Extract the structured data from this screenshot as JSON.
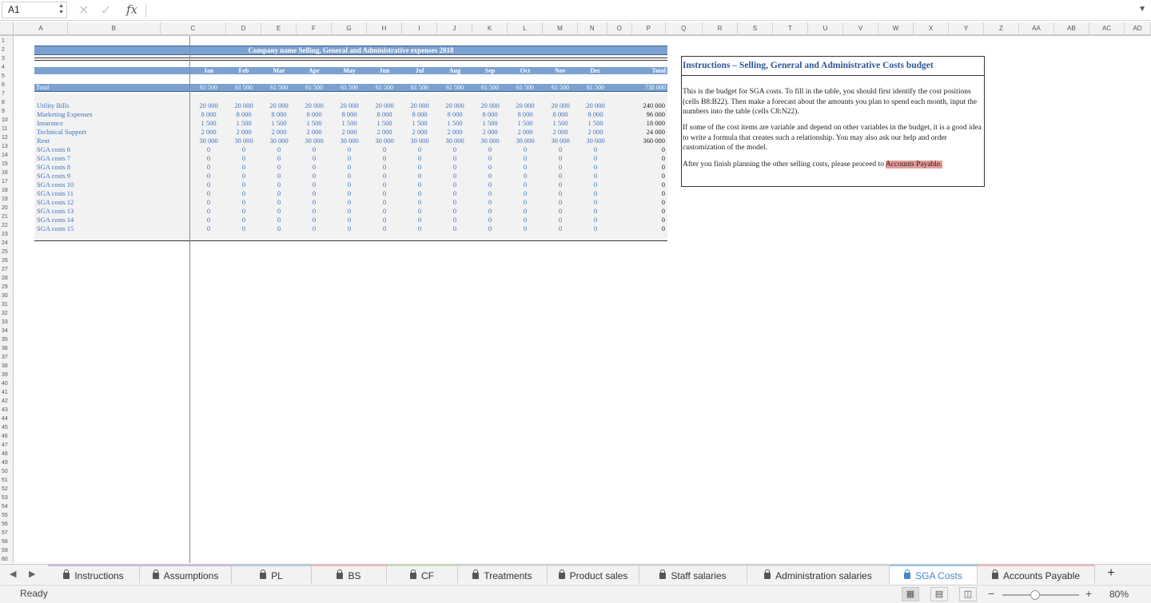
{
  "formula_bar": {
    "name_box": "A1",
    "formula": "",
    "fx": "fx",
    "cancel": "✕",
    "confirm": "✓"
  },
  "columns": [
    "A",
    "B",
    "C",
    "D",
    "E",
    "F",
    "G",
    "H",
    "I",
    "J",
    "K",
    "L",
    "M",
    "N",
    "O",
    "P",
    "Q",
    "R",
    "S",
    "T",
    "U",
    "V",
    "W",
    "X",
    "Y",
    "Z",
    "AA",
    "AB",
    "AC",
    "AD"
  ],
  "rows_visible": 60,
  "sheet": {
    "title": "Company name Selling, General and Administrative expenses 2018",
    "months": [
      "Jan",
      "Feb",
      "Mar",
      "Apr",
      "May",
      "Jun",
      "Jul",
      "Aug",
      "Sep",
      "Oct",
      "Nov",
      "Dec"
    ],
    "total_header": "Total",
    "total_row": {
      "label": "Total",
      "values": [
        "61 500",
        "61 500",
        "61 500",
        "61 500",
        "61 500",
        "61 500",
        "61 500",
        "61 500",
        "61 500",
        "61 500",
        "61 500",
        "61 500"
      ],
      "total": "738 000"
    },
    "items": [
      {
        "label": "Utility Bills",
        "values": [
          "20 000",
          "20 000",
          "20 000",
          "20 000",
          "20 000",
          "20 000",
          "20 000",
          "20 000",
          "20 000",
          "20 000",
          "20 000",
          "20 000"
        ],
        "total": "240 000"
      },
      {
        "label": "Marketing Expenses",
        "values": [
          "8 000",
          "8 000",
          "8 000",
          "8 000",
          "8 000",
          "8 000",
          "8 000",
          "8 000",
          "8 000",
          "8 000",
          "8 000",
          "8 000"
        ],
        "total": "96 000"
      },
      {
        "label": "Insurance",
        "values": [
          "1 500",
          "1 500",
          "1 500",
          "1 500",
          "1 500",
          "1 500",
          "1 500",
          "1 500",
          "1 500",
          "1 500",
          "1 500",
          "1 500"
        ],
        "total": "18 000"
      },
      {
        "label": "Technical Support",
        "values": [
          "2 000",
          "2 000",
          "2 000",
          "2 000",
          "2 000",
          "2 000",
          "2 000",
          "2 000",
          "2 000",
          "2 000",
          "2 000",
          "2 000"
        ],
        "total": "24 000"
      },
      {
        "label": "Rent",
        "values": [
          "30 000",
          "30 000",
          "30 000",
          "30 000",
          "30 000",
          "30 000",
          "30 000",
          "30 000",
          "30 000",
          "30 000",
          "30 000",
          "30 000"
        ],
        "total": "360 000"
      },
      {
        "label": "SGA costs 6",
        "values": [
          "0",
          "0",
          "0",
          "0",
          "0",
          "0",
          "0",
          "0",
          "0",
          "0",
          "0",
          "0"
        ],
        "total": "0"
      },
      {
        "label": "SGA costs 7",
        "values": [
          "0",
          "0",
          "0",
          "0",
          "0",
          "0",
          "0",
          "0",
          "0",
          "0",
          "0",
          "0"
        ],
        "total": "0"
      },
      {
        "label": "SGA costs 8",
        "values": [
          "0",
          "0",
          "0",
          "0",
          "0",
          "0",
          "0",
          "0",
          "0",
          "0",
          "0",
          "0"
        ],
        "total": "0"
      },
      {
        "label": "SGA costs 9",
        "values": [
          "0",
          "0",
          "0",
          "0",
          "0",
          "0",
          "0",
          "0",
          "0",
          "0",
          "0",
          "0"
        ],
        "total": "0"
      },
      {
        "label": "SGA costs 10",
        "values": [
          "0",
          "0",
          "0",
          "0",
          "0",
          "0",
          "0",
          "0",
          "0",
          "0",
          "0",
          "0"
        ],
        "total": "0"
      },
      {
        "label": "SGA costs 11",
        "values": [
          "0",
          "0",
          "0",
          "0",
          "0",
          "0",
          "0",
          "0",
          "0",
          "0",
          "0",
          "0"
        ],
        "total": "0"
      },
      {
        "label": "SGA costs 12",
        "values": [
          "0",
          "0",
          "0",
          "0",
          "0",
          "0",
          "0",
          "0",
          "0",
          "0",
          "0",
          "0"
        ],
        "total": "0"
      },
      {
        "label": "SGA costs 13",
        "values": [
          "0",
          "0",
          "0",
          "0",
          "0",
          "0",
          "0",
          "0",
          "0",
          "0",
          "0",
          "0"
        ],
        "total": "0"
      },
      {
        "label": "SGA costs 14",
        "values": [
          "0",
          "0",
          "0",
          "0",
          "0",
          "0",
          "0",
          "0",
          "0",
          "0",
          "0",
          "0"
        ],
        "total": "0"
      },
      {
        "label": "SGA costs 15",
        "values": [
          "0",
          "0",
          "0",
          "0",
          "0",
          "0",
          "0",
          "0",
          "0",
          "0",
          "0",
          "0"
        ],
        "total": "0"
      }
    ]
  },
  "instructions": {
    "title": "Instructions – Selling, General and Administrative Costs budget",
    "p1": "This is the budget for SGA costs. To fill in the table, you should first identify the cost positions (cells B8:B22). Then make a forecast about the amounts you plan to spend each month, input the numbers into the table (cells C8:N22).",
    "p2": "If some of the cost items are variable and depend on other variables in the budget, it is a good idea to write a formula that creates such a relationship. You may also ask our help and order customization of the model.",
    "p3_before": "After you finish planning the other selling costs, please proceed to ",
    "p3_link": "Accounts Payable."
  },
  "tabs": [
    {
      "label": "Instructions",
      "color": "#c9b8e0"
    },
    {
      "label": "Assumptions",
      "color": "#c9b8e0"
    },
    {
      "label": "PL",
      "color": "#b4c7e7"
    },
    {
      "label": "BS",
      "color": "#f4b6b6"
    },
    {
      "label": "CF",
      "color": "#c6e0b4"
    },
    {
      "label": "Treatments",
      "color": "#d9d9d9"
    },
    {
      "label": "Product sales",
      "color": "#d9d9d9"
    },
    {
      "label": "Staff salaries",
      "color": "#d9d9d9"
    },
    {
      "label": "Administration salaries",
      "color": "#d9d9d9"
    },
    {
      "label": "SGA Costs",
      "color": "#9dc3e6"
    },
    {
      "label": "Accounts Payable",
      "color": "#f4b6b6"
    }
  ],
  "active_tab": "SGA Costs",
  "status": {
    "text": "Ready",
    "zoom": "80%",
    "zoom_fraction": 0.8
  }
}
